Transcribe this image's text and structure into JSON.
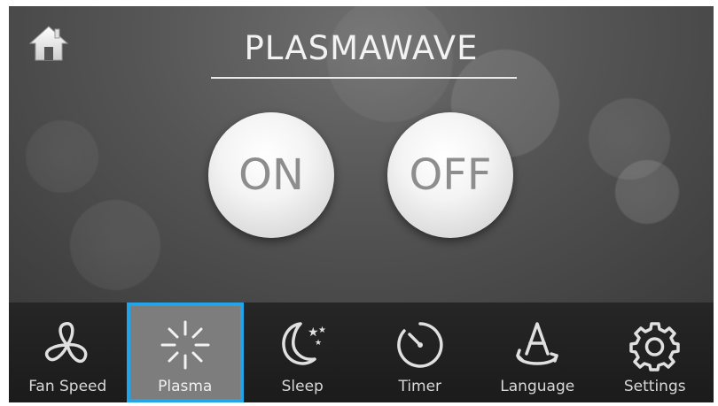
{
  "screen": {
    "title": "PLASMAWAVE",
    "home_icon": "home-icon"
  },
  "controls": {
    "on_label": "ON",
    "off_label": "OFF"
  },
  "nav": {
    "active_color": "#21a5e8",
    "items": [
      {
        "label": "Fan Speed",
        "icon": "fan-icon",
        "active": false
      },
      {
        "label": "Plasma",
        "icon": "plasma-icon",
        "active": true
      },
      {
        "label": "Sleep",
        "icon": "sleep-moon-icon",
        "active": false
      },
      {
        "label": "Timer",
        "icon": "timer-icon",
        "active": false
      },
      {
        "label": "Language",
        "icon": "language-icon",
        "active": false
      },
      {
        "label": "Settings",
        "icon": "gear-icon",
        "active": false
      }
    ]
  }
}
